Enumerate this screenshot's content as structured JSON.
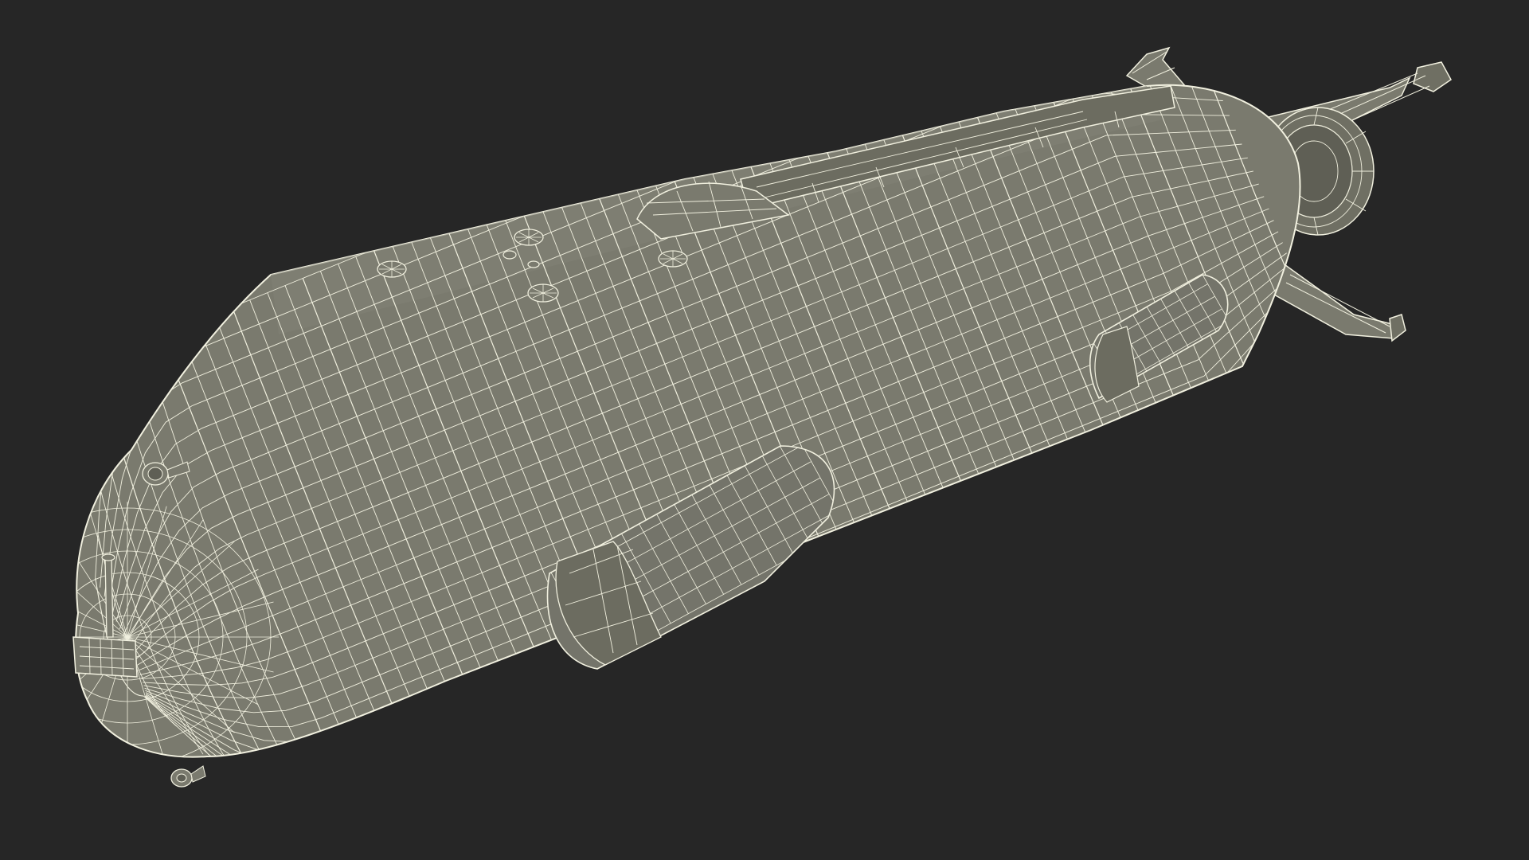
{
  "scene": {
    "background_color": "#262626",
    "mesh_fill_color": "#7a7a6e",
    "mesh_shade_color": "#686858",
    "wire_color": "#f1f0df",
    "subject": "wireframe-3d-model"
  }
}
